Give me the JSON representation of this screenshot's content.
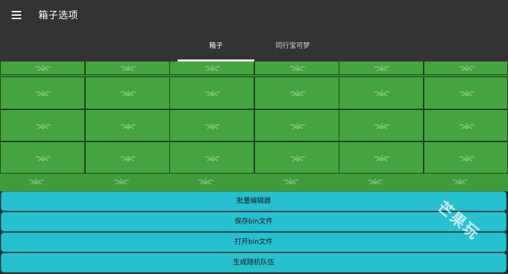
{
  "header": {
    "title": "箱子选项",
    "menu_icon": "hamburger-menu-icon"
  },
  "tabs": [
    {
      "label": "箱子",
      "selected": true
    },
    {
      "label": "同行宝可梦",
      "selected": false
    }
  ],
  "box": {
    "background_color": "#45a441",
    "rows": 4,
    "columns": 6
  },
  "actions": [
    {
      "label": "批量编辑器"
    },
    {
      "label": "保存bin文件"
    },
    {
      "label": "打开bin文件"
    },
    {
      "label": "生成随机队伍"
    }
  ],
  "colors": {
    "topbar": "#333333",
    "accent_button": "#27c0cf",
    "field": "#3f9a3b"
  },
  "watermark": "芒果玩"
}
